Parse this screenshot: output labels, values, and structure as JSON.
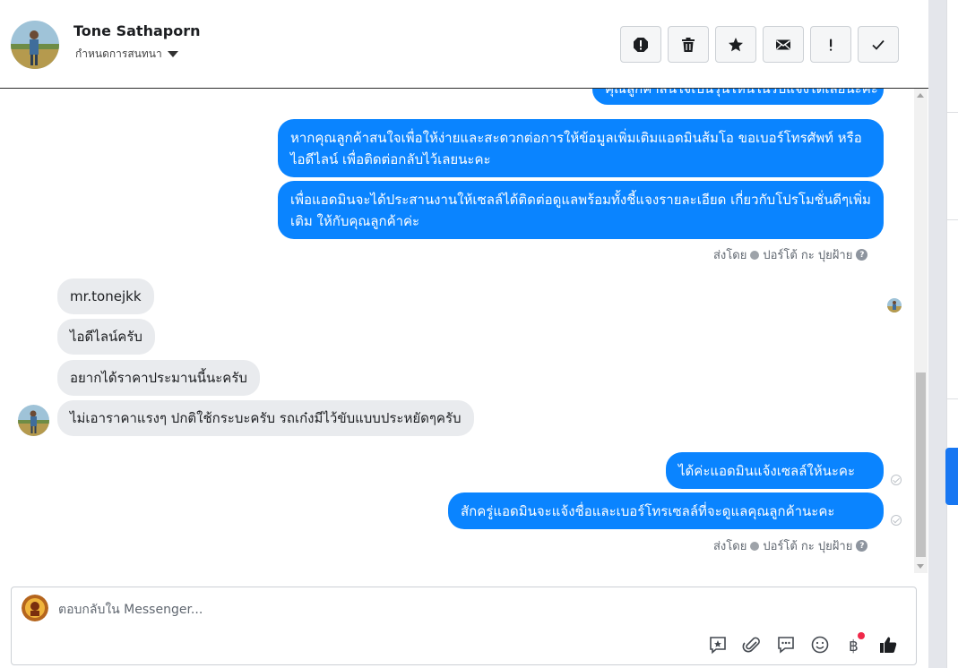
{
  "header": {
    "contact_name": "Tone Sathaporn",
    "assign_label": "กำหนดการสนทนา",
    "tools": [
      {
        "icon": "alert-icon",
        "glyph": "!"
      },
      {
        "icon": "trash-icon"
      },
      {
        "icon": "star-icon"
      },
      {
        "icon": "mail-icon"
      },
      {
        "icon": "exclamation-icon",
        "glyph": "!"
      },
      {
        "icon": "check-icon"
      }
    ]
  },
  "messages": {
    "cut_off_text": "คุณลูกค้าสนใจเป็นรุ่นไหนในรีบแจ้งได้เลยนะคะ",
    "out_1": "หากคุณลูกค้าสนใจเพื่อให้ง่ายและสะดวกต่อการให้ข้อมูลเพิ่มเติมแอดมินส้มโอ ขอเบอร์โทรศัพท์ หรือ ไอดีไลน์ เพื่อติดต่อกลับไว้เลยนะคะ",
    "out_2": "เพื่อแอดมินจะได้ประสานงานให้เซลล์ได้ติดต่อดูแลพร้อมทั้งชี้แจงรายละเอียด เกี่ยวกับโปรโมชั่นดีๆเพิ่มเติม ให้กับคุณลูกค้าค่ะ",
    "sent_by_label": "ส่งโดย",
    "sent_by_name": "ปอร์โต้ กะ ปุยฝ้าย",
    "in_1": "mr.tonejkk",
    "in_2": "ไอดีไลน์ครับ",
    "in_3": "อยากได้ราคาประมานนี้นะครับ",
    "in_4": "ไม่เอาราคาแรงๆ ปกติใช้กระบะครับ รถเก๋งมีไว้ขับแบบประหยัดๆครับ",
    "out_3": "ได้ค่ะแอดมินแจ้งเซลล์ให้นะคะ",
    "out_4": "สักครู่แอดมินจะแจ้งชื่อและเบอร์โทรเซลล์ที่จะดูแลคุณลูกค้านะคะ"
  },
  "composer": {
    "placeholder": "ตอบกลับใน Messenger...",
    "icons": [
      "saved-reply-icon",
      "attachment-icon",
      "chat-bubble-icon",
      "emoji-icon",
      "baht-icon",
      "thumbs-up-icon"
    ]
  },
  "colors": {
    "outgoing_bubble": "#0a84ff",
    "incoming_bubble": "#e9ebee",
    "accent": "#1877f2",
    "notification": "#f02849"
  }
}
